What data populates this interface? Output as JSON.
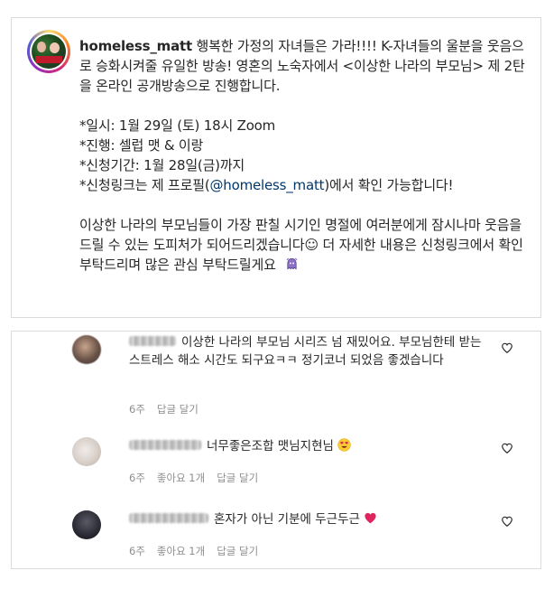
{
  "post": {
    "username": "homeless_matt",
    "caption_line1_rest": " 행복한 가정의 자녀들은 가라!!!! K-자녀들의 울분을 웃음으로 승화시켜줄 유일한 방송! 영혼의 노숙자에서 <이상한 나라의 부모님> 제 2탄을 온라인 공개방송으로 진행합니다.",
    "date_line": "*일시: 1월 29일 (토) 18시 Zoom",
    "host_line": "*진행: 셀럽 맷 & 이랑",
    "period_line": "*신청기간: 1월 28일(금)까지",
    "link_prefix": "*신청링크는 제 프로필(",
    "link_mention": "@homeless_matt",
    "link_suffix": ")에서 확인 가능합니다!",
    "closing_text": "이상한 나라의 부모님들이 가장 판칠 시기인 명절에 여러분에게 잠시나마 웃음을 드릴 수 있는 도피처가 되어드리겠습니다☺︎ 더 자세한 내용은 신청링크에서 확인 부탁드리며 많은 관심 부탁드릴게요"
  },
  "comments": [
    {
      "text": "이상한 나라의 부모님 시리즈 넘 재밌어요. 부모님한테 받는 스트레스 해소 시간도 되구요ㅋㅋ 정기코너 되었음 좋겠습니다",
      "time": "6주",
      "likes": "",
      "reply": "답글 달기"
    },
    {
      "text": "너무좋은조합 맷님지현님",
      "time": "6주",
      "likes": "좋아요 1개",
      "reply": "답글 달기"
    },
    {
      "text": "혼자가 아닌 기분에 두근두근",
      "time": "6주",
      "likes": "좋아요 1개",
      "reply": "답글 달기"
    }
  ],
  "icons": {
    "like": "heart-outline-icon",
    "emoji_smile": "smiling-face-emoji",
    "emoji_heart_eyes": "heart-eyes-emoji",
    "emoji_heart": "red-heart-emoji",
    "emoji_ghost": "ghost-emoji"
  },
  "colors": {
    "mention": "#00376b",
    "meta": "#8e8e8e",
    "heart": "#e0245e"
  }
}
